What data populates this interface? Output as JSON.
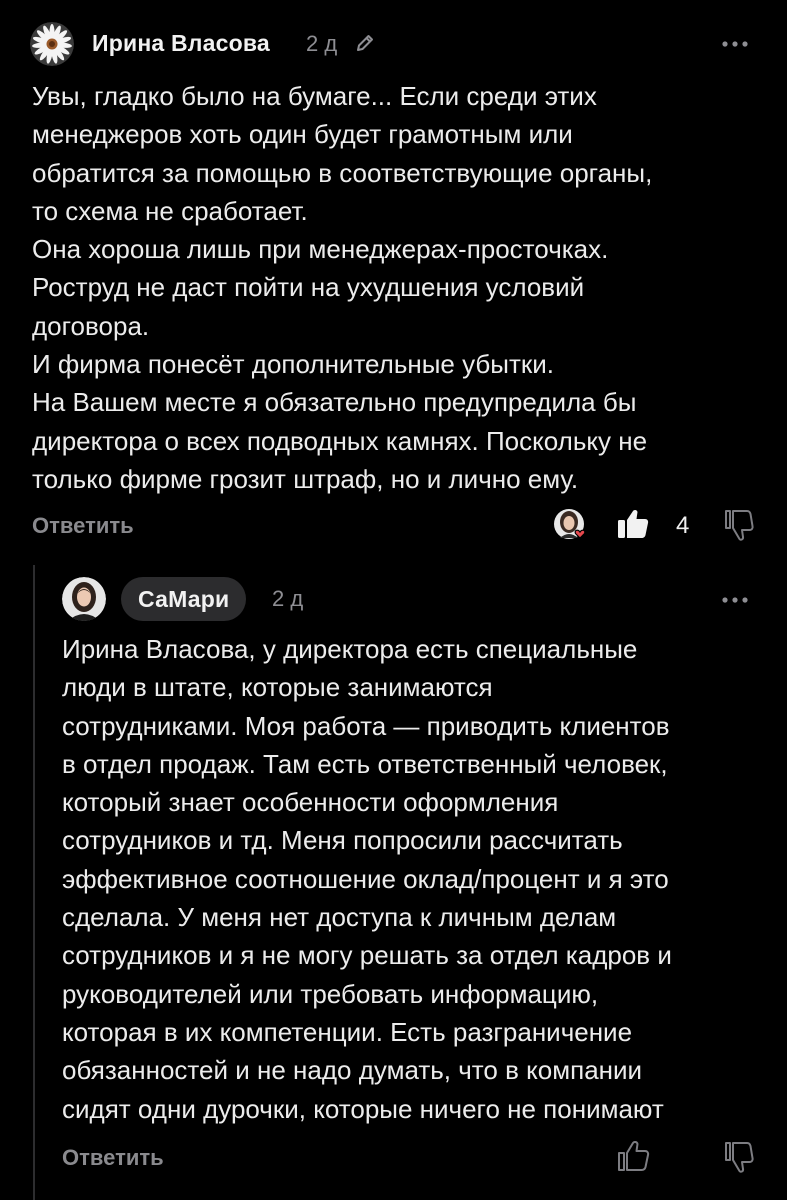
{
  "comments": [
    {
      "author": "Ирина Власова",
      "time": "2 д",
      "text": "Увы, гладко было на бумаге... Если среди этих\nменеджеров хоть один будет грамотным или\nобратится за помощью в соответствующие органы,\nто схема не сработает.\nОна хороша лишь при менеджерах-просточках.\nРоструд не даст пойти на ухудшения условий\nдоговора.\nИ фирма понесёт дополнительные убытки.\nНа Вашем месте я обязательно предупредила бы\nдиректора о всех подводных камнях. Поскольку не\nтолько фирме грозит штраф, но и лично ему.",
      "reply_label": "Ответить",
      "likes": "4",
      "icons": {
        "avatar": "daisy-avatar-icon",
        "edited": "pencil-icon",
        "more": "more-dots-icon",
        "reactor": "reactor-avatar-with-heart-icon",
        "like": "thumbs-up-filled-icon",
        "dislike": "thumbs-down-outline-icon"
      }
    },
    {
      "author": "СаМари",
      "time": "2 д",
      "text": "Ирина Власова, у директора есть специальные\nлюди в штате, которые занимаются\nсотрудниками. Моя работа — приводить клиентов\nв отдел продаж. Там есть ответственный человек,\nкоторый знает особенности оформления\nсотрудников и тд. Меня попросили рассчитать\nэффективное соотношение оклад/процент и я это\nсделала. У меня нет доступа к личным делам\nсотрудников и я не могу решать за отдел кадров и\nруководителей или требовать информацию,\nкоторая в их компетенции. Есть разграничение\nобязанностей и не надо думать, что в компании\nсидят одни дурочки, которые ничего не понимают",
      "reply_label": "Ответить",
      "icons": {
        "avatar": "woman-portrait-avatar-icon",
        "more": "more-dots-icon",
        "like": "thumbs-up-outline-icon",
        "dislike": "thumbs-down-outline-icon"
      }
    }
  ],
  "colors": {
    "background": "#000000",
    "text": "#ececec",
    "muted": "#8e8e93",
    "pill": "#2c2c2e",
    "heart": "#e5484d"
  }
}
